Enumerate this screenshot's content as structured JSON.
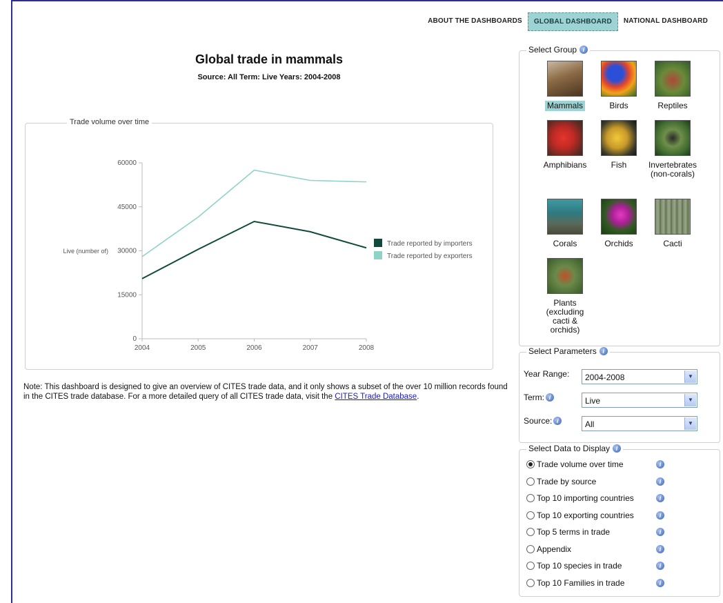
{
  "nav": {
    "items": [
      {
        "label": "About the dashboards",
        "active": false
      },
      {
        "label": "Global dashboard",
        "active": true
      },
      {
        "label": "National dashboard",
        "active": false
      }
    ]
  },
  "header": {
    "title": "Global trade in mammals",
    "subtitle": "Source: All Term: Live Years: 2004-2008"
  },
  "chart_panel": {
    "legend_title": "Trade volume over time"
  },
  "chart_data": {
    "type": "line",
    "x": [
      2004,
      2005,
      2006,
      2007,
      2008
    ],
    "series": [
      {
        "name": "Trade reported by importers",
        "values": [
          20500,
          30500,
          40000,
          36500,
          31000
        ],
        "color": "#0f4a3c"
      },
      {
        "name": "Trade reported by exporters",
        "values": [
          28000,
          41500,
          57500,
          54000,
          53500
        ],
        "color": "#8fd3c8"
      }
    ],
    "ylabel": "Live (number of)",
    "yticks": [
      0,
      15000,
      30000,
      45000,
      60000
    ],
    "xticks": [
      "2004",
      "2005",
      "2006",
      "2007",
      "2008"
    ],
    "ylim": [
      0,
      60000
    ],
    "grid": false,
    "legend": "right"
  },
  "note": {
    "text": "Note: This dashboard is designed to give an overview of CITES trade data, and it only shows a subset of the over 10 million records found in the CITES trade database. For a more detailed query of all CITES trade data, visit the ",
    "link": "CITES Trade Database",
    "end": "."
  },
  "group_panel": {
    "title": "Select Group",
    "items": [
      {
        "label": "Mammals",
        "selected": true,
        "icon": "mammal-photo"
      },
      {
        "label": "Birds",
        "selected": false,
        "icon": "bird-photo"
      },
      {
        "label": "Reptiles",
        "selected": false,
        "icon": "reptile-photo"
      },
      {
        "label": "Amphibians",
        "selected": false,
        "icon": "amphibian-photo"
      },
      {
        "label": "Fish",
        "selected": false,
        "icon": "fish-photo"
      },
      {
        "label": "Invertebrates (non-corals)",
        "selected": false,
        "icon": "invertebrate-photo"
      },
      {
        "label": "Corals",
        "selected": false,
        "icon": "coral-photo"
      },
      {
        "label": "Orchids",
        "selected": false,
        "icon": "orchid-photo"
      },
      {
        "label": "Cacti",
        "selected": false,
        "icon": "cactus-photo"
      },
      {
        "label": "Plants (excluding cacti & orchids)",
        "selected": false,
        "icon": "plant-photo"
      }
    ]
  },
  "params_panel": {
    "title": "Select Parameters",
    "year_label": "Year Range:",
    "year_value": "2004-2008",
    "term_label": "Term:",
    "term_value": "Live",
    "source_label": "Source:",
    "source_value": "All"
  },
  "display_panel": {
    "title": "Select Data to Display",
    "options": [
      {
        "label": "Trade volume over time",
        "checked": true
      },
      {
        "label": "Trade by source",
        "checked": false
      },
      {
        "label": "Top 10 importing countries",
        "checked": false
      },
      {
        "label": "Top 10 exporting countries",
        "checked": false
      },
      {
        "label": "Top 5 terms in trade",
        "checked": false
      },
      {
        "label": "Appendix",
        "checked": false
      },
      {
        "label": "Top 10 species in trade",
        "checked": false
      },
      {
        "label": "Top 10 Families in trade",
        "checked": false
      }
    ]
  },
  "colors": {
    "accent": "#9ed3d3",
    "link": "#1a1acc",
    "frame": "#2a2f8f"
  }
}
